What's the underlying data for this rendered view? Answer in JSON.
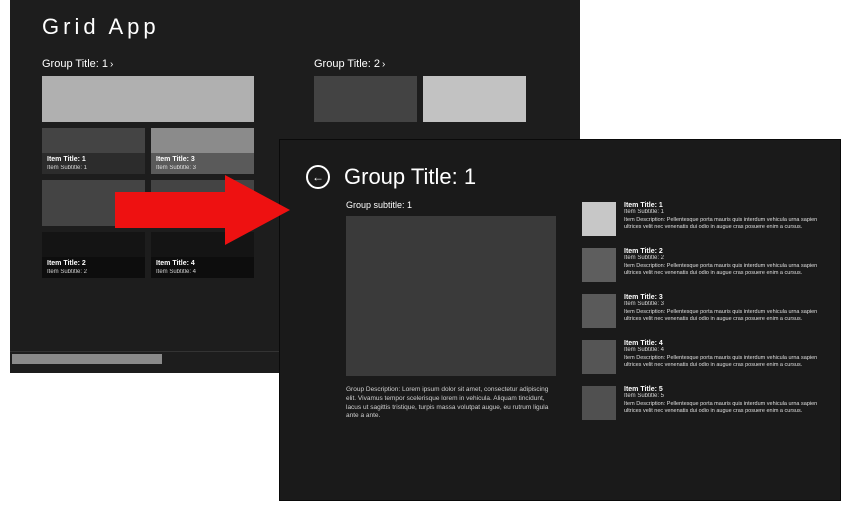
{
  "back_window": {
    "app_title": "Grid   App",
    "group1": {
      "header": "Group Title: 1",
      "chevron": "›",
      "tiles": [
        {
          "title": "Item Title: 1",
          "sub": "Item Subtitle: 1"
        },
        {
          "title": "Item Title: 3",
          "sub": "Item Subtitle: 3"
        },
        {
          "title": "Item Title: 2",
          "sub": "Item Subtitle: 2"
        },
        {
          "title": "Item Title: 4",
          "sub": "Item Subtitle: 4"
        }
      ]
    },
    "group2": {
      "header": "Group Title: 2",
      "chevron": "›"
    }
  },
  "front_window": {
    "back_glyph": "←",
    "title": "Group Title: 1",
    "subtitle": "Group subtitle: 1",
    "description": "Group Description: Lorem ipsum dolor sit amet, consectetur adipiscing elit. Vivamus tempor scelerisque lorem in vehicula. Aliquam tincidunt, lacus ut sagittis tristique, turpis massa volutpat augue, eu rutrum ligula ante a ante.",
    "items": [
      {
        "title": "Item Title: 1",
        "sub": "Item Subtitle: 1",
        "desc": "Item Description: Pellentesque porta mauris quis interdum vehicula urna sapien ultrices velit nec venenatis dui odio in augue cras posuere enim a cursus."
      },
      {
        "title": "Item Title: 2",
        "sub": "Item Subtitle: 2",
        "desc": "Item Description: Pellentesque porta mauris quis interdum vehicula urna sapien ultrices velit nec venenatis dui odio in augue cras posuere enim a cursus."
      },
      {
        "title": "Item Title: 3",
        "sub": "Item Subtitle: 3",
        "desc": "Item Description: Pellentesque porta mauris quis interdum vehicula urna sapien ultrices velit nec venenatis dui odio in augue cras posuere enim a cursus."
      },
      {
        "title": "Item Title: 4",
        "sub": "Item Subtitle: 4",
        "desc": "Item Description: Pellentesque porta mauris quis interdum vehicula urna sapien ultrices velit nec venenatis dui odio in augue cras posuere enim a cursus."
      },
      {
        "title": "Item Title: 5",
        "sub": "Item Subtitle: 5",
        "desc": "Item Description: Pellentesque porta mauris quis interdum vehicula urna sapien ultrices velit nec venenatis dui odio in augue cras posuere enim a cursus."
      }
    ]
  }
}
